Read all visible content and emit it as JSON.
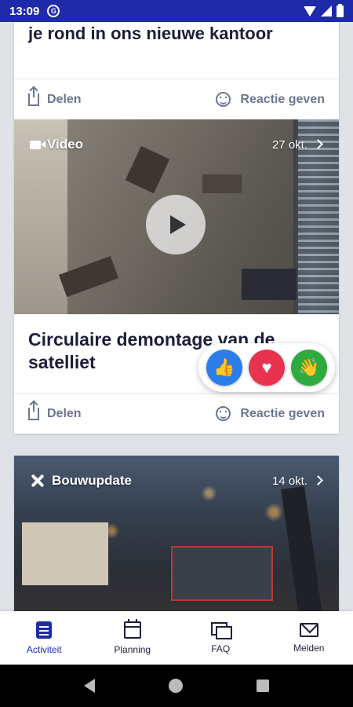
{
  "status_bar": {
    "time": "13:09",
    "sync_glyph": "G"
  },
  "cards": [
    {
      "title": "je rond in ons nieuwe kantoor",
      "share_label": "Delen",
      "react_label": "Reactie geven"
    },
    {
      "category": "Video",
      "date": "27 okt.",
      "title": "Circulaire demontage van de satelliet",
      "share_label": "Delen",
      "react_label": "Reactie geven"
    },
    {
      "category": "Bouwupdate",
      "date": "14 okt."
    }
  ],
  "reactions": [
    {
      "name": "like",
      "glyph": "👍",
      "color": "#2b7de9"
    },
    {
      "name": "love",
      "glyph": "♥",
      "color": "#e8334f"
    },
    {
      "name": "wave",
      "glyph": "👋",
      "color": "#2eaa3e"
    }
  ],
  "bottom_nav": {
    "items": [
      {
        "label": "Activiteit",
        "icon": "activity-icon",
        "active": true
      },
      {
        "label": "Planning",
        "icon": "calendar-icon",
        "active": false
      },
      {
        "label": "FAQ",
        "icon": "faq-icon",
        "active": false
      },
      {
        "label": "Melden",
        "icon": "mail-icon",
        "active": false
      }
    ]
  },
  "colors": {
    "primary": "#1f2aa8",
    "text_dark": "#1a1f3a",
    "muted": "#6b7691",
    "background": "#dfe3e8"
  }
}
